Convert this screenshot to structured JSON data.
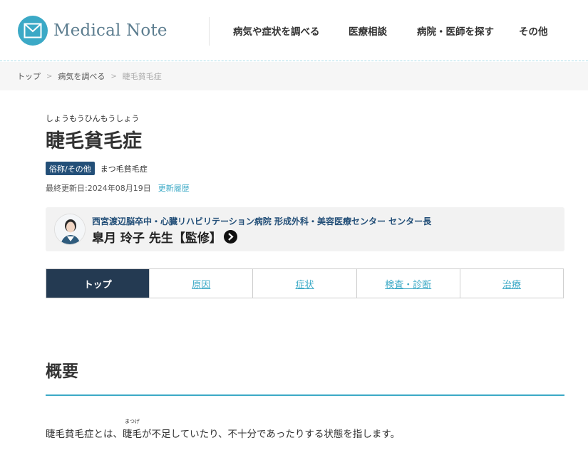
{
  "header": {
    "logo_text": "Medical Note",
    "nav": [
      {
        "label": "病気や症状を調べる"
      },
      {
        "label": "医療相談"
      },
      {
        "label": "病院・医師を探す"
      },
      {
        "label": "その他"
      }
    ]
  },
  "breadcrumb": {
    "items": [
      "トップ",
      "病気を調べる"
    ],
    "current": "睫毛貧毛症"
  },
  "title": {
    "reading": "しょうもうひんもうしょう",
    "name": "睫毛貧毛症",
    "alias_badge": "俗称/その他",
    "alias": "まつ毛貧毛症",
    "updated": "最終更新日:2024年08月19日",
    "history_link": "更新履歴"
  },
  "doctor": {
    "affiliation": "西宮渡辺脳卒中・心臓リハビリテーション病院 形成外科・美容医療センター センター長",
    "name": "皐月 玲子 先生【監修】"
  },
  "tabs": [
    {
      "label": "トップ",
      "active": true
    },
    {
      "label": "原因"
    },
    {
      "label": "症状"
    },
    {
      "label": "検査・診断"
    },
    {
      "label": "治療"
    }
  ],
  "section": {
    "heading": "概要",
    "text_before": "睫毛貧毛症とは、",
    "ruby_base": "睫毛",
    "ruby_text": "まつげ",
    "text_after": "が不足していたり、不十分であったりする状態を指します。"
  },
  "colors": {
    "accent": "#3ba9c6",
    "navy": "#234f78",
    "tab_active": "#243a52"
  }
}
